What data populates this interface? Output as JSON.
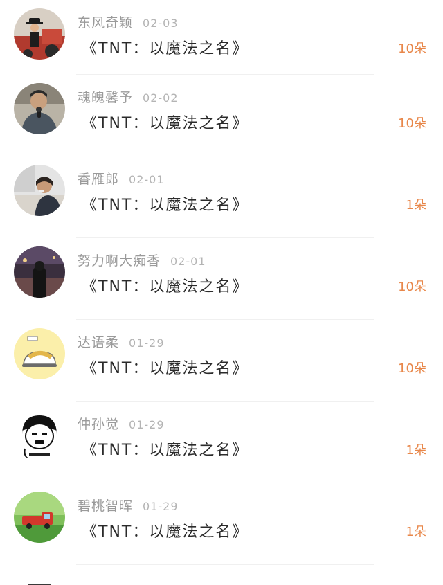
{
  "gift_records": [
    {
      "sender": "东风奇颖",
      "date": "02-03",
      "gift": "《TNT：以魔法之名》",
      "count": "10朵",
      "avatar_icon": "avatar-man-with-tractor"
    },
    {
      "sender": "魂魄馨予",
      "date": "02-02",
      "gift": "《TNT：以魔法之名》",
      "count": "10朵",
      "avatar_icon": "avatar-man-with-microphone"
    },
    {
      "sender": "香雁郎",
      "date": "02-01",
      "gift": "《TNT：以魔法之名》",
      "count": "1朵",
      "avatar_icon": "avatar-person-lying"
    },
    {
      "sender": "努力啊大痴香",
      "date": "02-01",
      "gift": "《TNT：以魔法之名》",
      "count": "10朵",
      "avatar_icon": "avatar-girl-night"
    },
    {
      "sender": "达语柔",
      "date": "01-29",
      "gift": "《TNT：以魔法之名》",
      "count": "10朵",
      "avatar_icon": "avatar-cartoon-egg"
    },
    {
      "sender": "仲孙觉",
      "date": "01-29",
      "gift": "《TNT：以魔法之名》",
      "count": "1朵",
      "avatar_icon": "avatar-meme-face"
    },
    {
      "sender": "碧桃智晖",
      "date": "01-29",
      "gift": "《TNT：以魔法之名》",
      "count": "1朵",
      "avatar_icon": "avatar-toy-truck-grass"
    }
  ],
  "colors": {
    "name": "#9a9a9a",
    "date": "#b4b4b4",
    "gift": "#2b2b2b",
    "count": "#e8874a"
  }
}
